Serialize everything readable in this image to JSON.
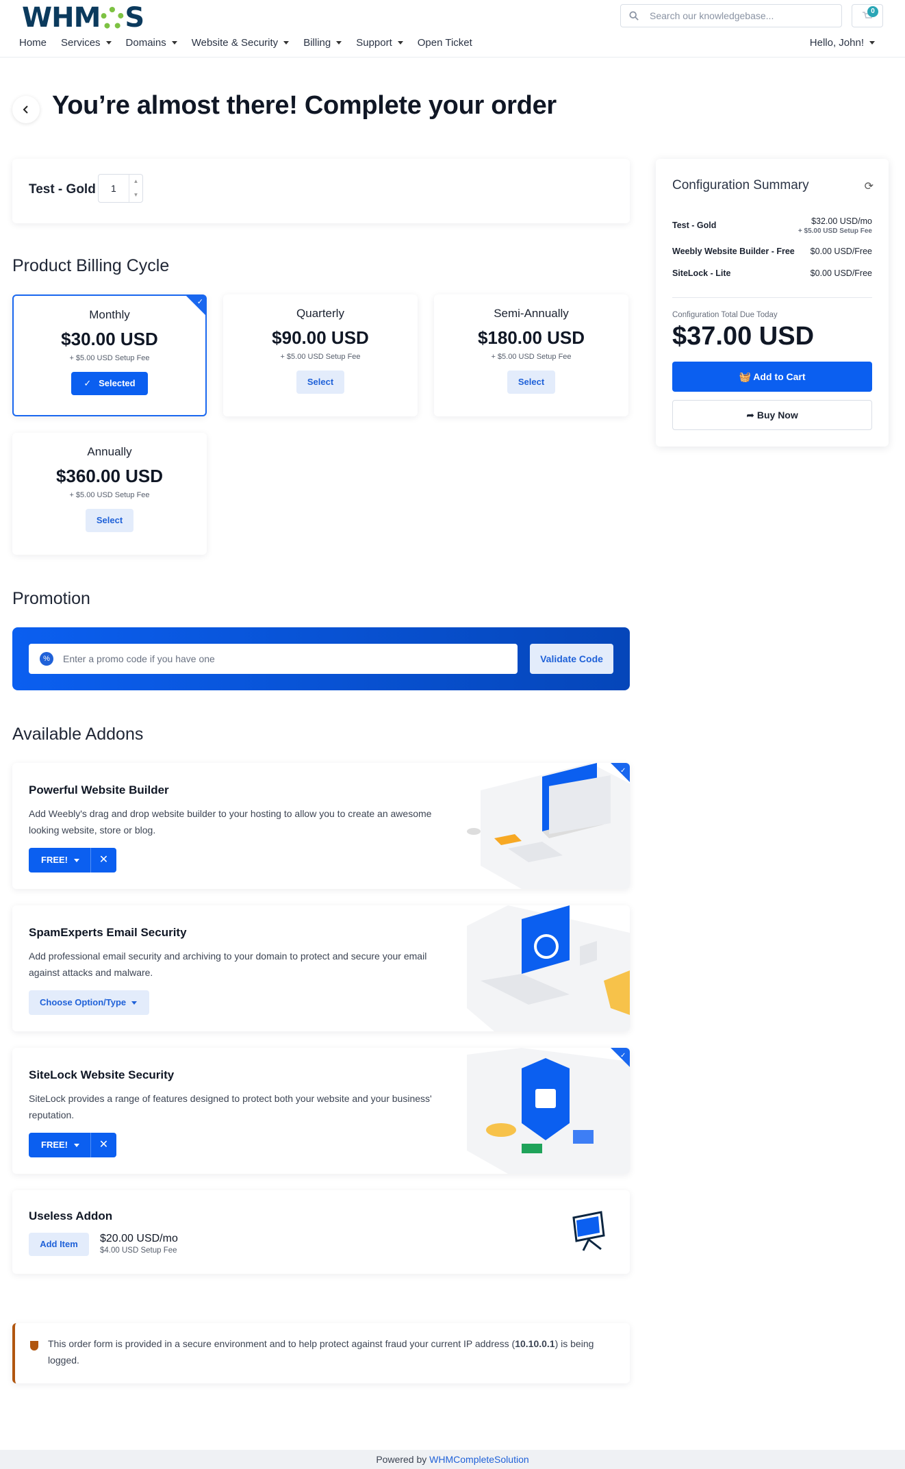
{
  "brand": {
    "logo_text_a": "WHM",
    "logo_text_b": "S"
  },
  "search": {
    "placeholder": "Search our knowledgebase..."
  },
  "cart": {
    "count": "0"
  },
  "nav": [
    "Home",
    "Services",
    "Domains",
    "Website & Security",
    "Billing",
    "Support",
    "Open Ticket"
  ],
  "user": {
    "greeting": "Hello, John!"
  },
  "page": {
    "title": "You’re almost there! Complete your order"
  },
  "product": {
    "name": "Test - Gold",
    "quantity": "1"
  },
  "billing": {
    "heading": "Product Billing Cycle",
    "cycles": [
      {
        "name": "Monthly",
        "price": "$30.00 USD",
        "fee": "+ $5.00 USD Setup Fee",
        "button": "Selected"
      },
      {
        "name": "Quarterly",
        "price": "$90.00 USD",
        "fee": "+ $5.00 USD Setup Fee",
        "button": "Select"
      },
      {
        "name": "Semi-Annually",
        "price": "$180.00 USD",
        "fee": "+ $5.00 USD Setup Fee",
        "button": "Select"
      },
      {
        "name": "Annually",
        "price": "$360.00 USD",
        "fee": "+ $5.00 USD Setup Fee",
        "button": "Select"
      }
    ]
  },
  "promotion": {
    "heading": "Promotion",
    "placeholder": "Enter a promo code if you have one",
    "button": "Validate Code"
  },
  "addons": {
    "heading": "Available Addons",
    "items": [
      {
        "title": "Powerful Website Builder",
        "desc": "Add Weebly's drag and drop website builder to your hosting to allow you to create an awesome looking website, store or blog.",
        "option": "FREE!"
      },
      {
        "title": "SpamExperts Email Security",
        "desc": "Add professional email security and archiving to your domain to protect and secure your email against attacks and malware.",
        "option": "Choose Option/Type"
      },
      {
        "title": "SiteLock Website Security",
        "desc": "SiteLock provides a range of features designed to protect both your website and your business' reputation.",
        "option": "FREE!"
      },
      {
        "title": "Useless Addon",
        "button": "Add Item",
        "price": "$20.00 USD/mo",
        "fee": "$4.00 USD Setup Fee"
      }
    ]
  },
  "summary": {
    "title": "Configuration Summary",
    "lines": [
      {
        "name": "Test - Gold",
        "price": "$32.00 USD/mo",
        "fee": "+ $5.00 USD Setup Fee"
      },
      {
        "name": "Weebly Website Builder - Free",
        "price": "$0.00 USD/Free"
      },
      {
        "name": "SiteLock - Lite",
        "price": "$0.00 USD/Free"
      }
    ],
    "total_label": "Configuration Total Due Today",
    "total": "$37.00 USD",
    "add_to_cart": "Add to Cart",
    "buy_now": "Buy Now"
  },
  "notice": {
    "text_a": "This order form is provided in a secure environment and to help protect against fraud your current IP address (",
    "ip": "10.10.0.1",
    "text_b": ") is being logged."
  },
  "footer": {
    "prefix": "Powered by ",
    "link": "WHMCompleteSolution"
  },
  "colors": {
    "primary": "#0b5ff0",
    "brand_dark": "#0b3a5d",
    "gear_green": "#7dc243",
    "notice_accent": "#b1560f"
  }
}
